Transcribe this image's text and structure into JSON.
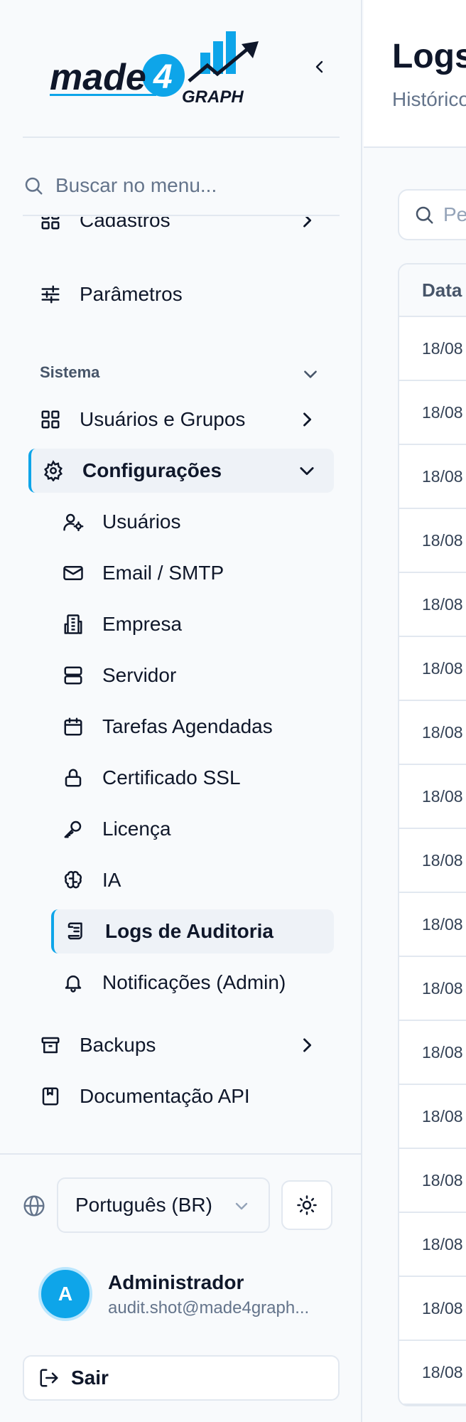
{
  "brand": {
    "name_part1": "made",
    "name_part2": "4",
    "name_part3": "GRAPH",
    "primary_color": "#0ea5e9"
  },
  "sidebar": {
    "search_placeholder": "Buscar no menu...",
    "top_items": [
      {
        "label": "Cadastros",
        "icon": "grid-icon",
        "has_chevron": true
      },
      {
        "label": "Parâmetros",
        "icon": "sliders-icon",
        "has_chevron": false
      }
    ],
    "section": {
      "label": "Sistema"
    },
    "system_items": [
      {
        "label": "Usuários e Grupos",
        "icon": "grid-icon"
      },
      {
        "label": "Configurações",
        "icon": "gear-icon",
        "active": true,
        "expanded": true
      }
    ],
    "config_subitems": [
      {
        "label": "Usuários",
        "icon": "user-cog-icon"
      },
      {
        "label": "Email / SMTP",
        "icon": "mail-icon"
      },
      {
        "label": "Empresa",
        "icon": "building-icon"
      },
      {
        "label": "Servidor",
        "icon": "server-icon"
      },
      {
        "label": "Tarefas Agendadas",
        "icon": "calendar-icon"
      },
      {
        "label": "Certificado SSL",
        "icon": "lock-icon"
      },
      {
        "label": "Licença",
        "icon": "key-icon"
      },
      {
        "label": "IA",
        "icon": "brain-icon"
      },
      {
        "label": "Logs de Auditoria",
        "icon": "scroll-icon",
        "active": true
      },
      {
        "label": "Notificações (Admin)",
        "icon": "bell-icon"
      }
    ],
    "bottom_items": [
      {
        "label": "Backups",
        "icon": "archive-icon"
      },
      {
        "label": "Documentação API",
        "icon": "book-icon"
      }
    ],
    "language": "Português (BR)",
    "user": {
      "initial": "A",
      "name": "Administrador",
      "email": "audit.shot@made4graph..."
    },
    "logout_label": "Sair"
  },
  "main": {
    "title": "Logs",
    "subtitle": "Histórico",
    "search_placeholder": "Pe",
    "table": {
      "header": "Data",
      "rows": [
        "18/08",
        "18/08",
        "18/08",
        "18/08",
        "18/08",
        "18/08",
        "18/08",
        "18/08",
        "18/08",
        "18/08",
        "18/08",
        "18/08",
        "18/08",
        "18/08",
        "18/08",
        "18/08",
        "18/08"
      ]
    }
  }
}
